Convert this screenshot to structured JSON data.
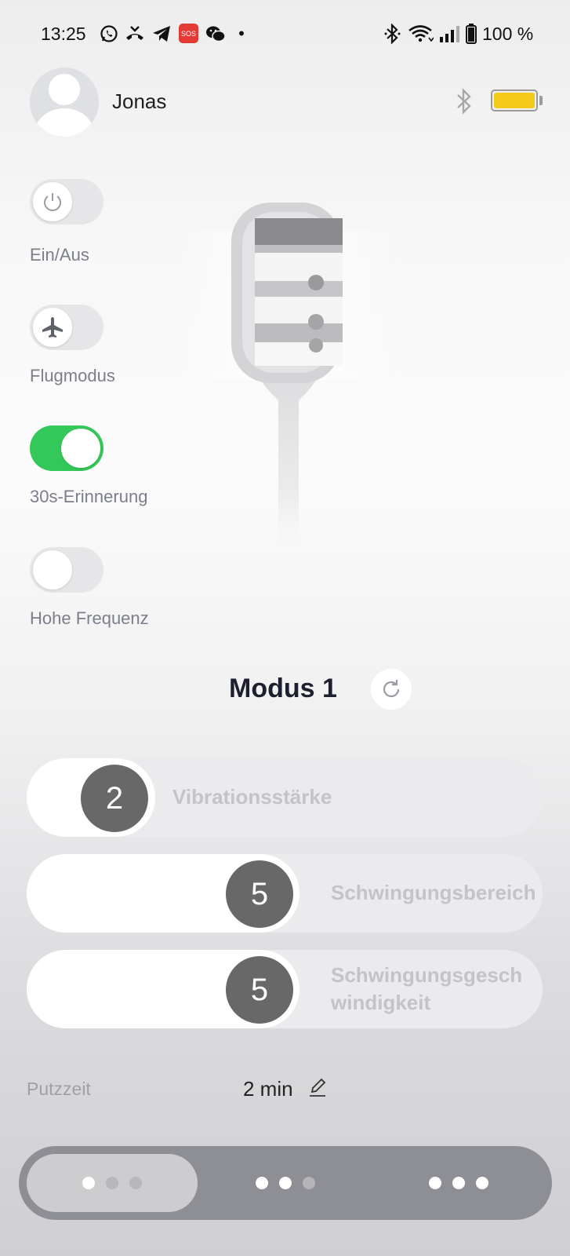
{
  "status_bar": {
    "time": "13:25",
    "battery_text": "100 %",
    "sos_label": "SOS",
    "dot": "•",
    "icons": [
      "whatsapp-icon",
      "missed-call-icon",
      "telegram-icon",
      "sos-icon",
      "wechat-icon",
      "bluetooth-icon",
      "wifi-icon",
      "signal-icon",
      "battery-icon"
    ]
  },
  "header": {
    "username": "Jonas",
    "bluetooth_icon": "bluetooth-icon",
    "device_battery_color": "#f5c91a"
  },
  "toggles": [
    {
      "label": "Ein/Aus",
      "on": false,
      "icon": "power-icon"
    },
    {
      "label": "Flugmodus",
      "on": false,
      "icon": "airplane-icon"
    },
    {
      "label": "30s-Erinnerung",
      "on": true,
      "icon": ""
    },
    {
      "label": "Hohe Frequenz",
      "on": false,
      "icon": ""
    }
  ],
  "mode": {
    "title": "Modus 1",
    "refresh_icon": "refresh-icon"
  },
  "sliders": [
    {
      "label": "Vibrationsstärke",
      "value": "2"
    },
    {
      "label": "Schwingungsbereich",
      "value": "5"
    },
    {
      "label_line1": "Schwingungsgesch",
      "label_line2": "windigkeit",
      "value": "5"
    }
  ],
  "brushing_time": {
    "label": "Putzzeit",
    "value": "2 min",
    "edit_icon": "pencil-icon"
  },
  "pager": {
    "active_index": 0,
    "pages": 3
  },
  "colors": {
    "toggle_on": "#34c759",
    "slider_knob": "#686868",
    "battery_fill": "#f5c91a"
  }
}
